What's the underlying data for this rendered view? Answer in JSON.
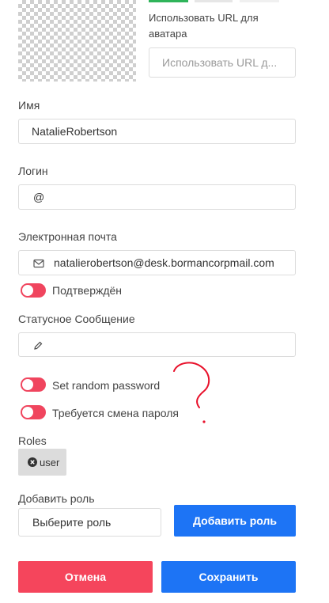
{
  "avatar": {
    "url_label": "Использовать URL для аватара",
    "url_placeholder": "Использовать URL д..."
  },
  "name": {
    "label": "Имя",
    "value": "NatalieRobertson"
  },
  "login": {
    "label": "Логин",
    "prefix": "@",
    "value": ""
  },
  "email": {
    "label": "Электронная почта",
    "value": "natalierobertson@desk.bormancorpmail.com",
    "verified_label": "Подтверждён",
    "icon": "mail-icon"
  },
  "status": {
    "label": "Статусное Сообщение",
    "value": "",
    "icon": "pencil-icon"
  },
  "toggles": {
    "random_password": "Set random password",
    "require_password_change": "Требуется смена пароля"
  },
  "roles": {
    "label": "Roles",
    "items": [
      {
        "name": "user",
        "remove_icon": "remove-x-icon"
      }
    ]
  },
  "add_role": {
    "label": "Добавить роль",
    "select_placeholder": "Выберите роль",
    "button": "Добавить роль"
  },
  "actions": {
    "cancel": "Отмена",
    "save": "Сохранить"
  },
  "colors": {
    "toggle": "#f0455e",
    "primary": "#1d74f5",
    "danger": "#f5455c",
    "annotation": "#e8102a"
  }
}
